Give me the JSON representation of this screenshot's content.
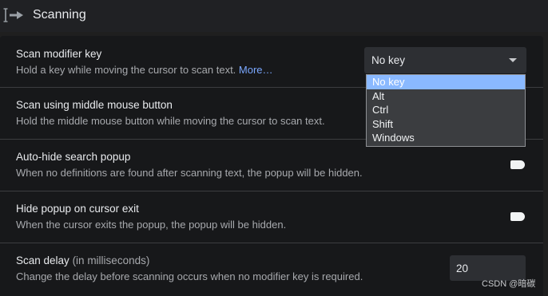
{
  "section": {
    "title": "Scanning",
    "icon": "scan-arrow-icon"
  },
  "rows": {
    "modifier": {
      "title": "Scan modifier key",
      "desc": "Hold a key while moving the cursor to scan text.",
      "link": "More…",
      "selected_value": "No key",
      "options": [
        "No key",
        "Alt",
        "Ctrl",
        "Shift",
        "Windows"
      ]
    },
    "middle_mouse": {
      "title": "Scan using middle mouse button",
      "desc": "Hold the middle mouse button while moving the cursor to scan text."
    },
    "auto_hide": {
      "title": "Auto-hide search popup",
      "desc": "When no definitions are found after scanning text, the popup will be hidden."
    },
    "hide_on_exit": {
      "title": "Hide popup on cursor exit",
      "desc": "When the cursor exits the popup, the popup will be hidden."
    },
    "scan_delay": {
      "title": "Scan delay",
      "title_suffix": "(in milliseconds)",
      "desc": "Change the delay before scanning occurs when no modifier key is required.",
      "value": "20"
    }
  },
  "watermark": "CSDN @暗碳",
  "colors": {
    "background": "#1f1f1f",
    "panel": "#17181a",
    "link": "#7aa7ff",
    "selected_option": "#8ab9ff"
  }
}
